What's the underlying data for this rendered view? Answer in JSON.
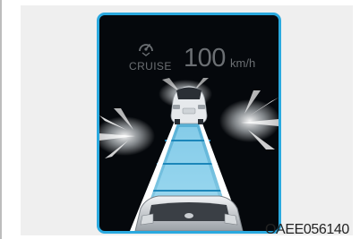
{
  "cluster": {
    "cruise_label": "CRUISE",
    "set_speed": "100",
    "speed_unit": "km/h",
    "icon": "cruise-speedometer-icon"
  },
  "figure_code": "OAEE056140",
  "colors": {
    "frame": "#2aa9df",
    "screen": "#05080c",
    "lane": "#8fd3f0",
    "text": "#6b6f73"
  }
}
